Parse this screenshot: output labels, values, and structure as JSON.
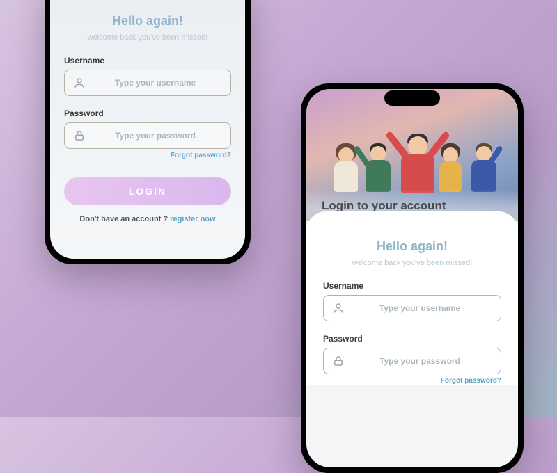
{
  "phone1": {
    "hello": "Hello again!",
    "welcome": "welcome back you've been missed!",
    "username_label": "Username",
    "username_placeholder": "Type your username",
    "password_label": "Password",
    "password_placeholder": "Type your password",
    "forgot": "Forgot password?",
    "login_button": "LOGIN",
    "signup_prompt": "Don't have an account ? ",
    "signup_link": "register now"
  },
  "phone2": {
    "hero_title": "Login to your account",
    "hello": "Hello again!",
    "welcome": "welcome back you've been missed!",
    "username_label": "Username",
    "username_placeholder": "Type your username",
    "password_label": "Password",
    "password_placeholder": "Type your password",
    "forgot": "Forgot password?"
  }
}
